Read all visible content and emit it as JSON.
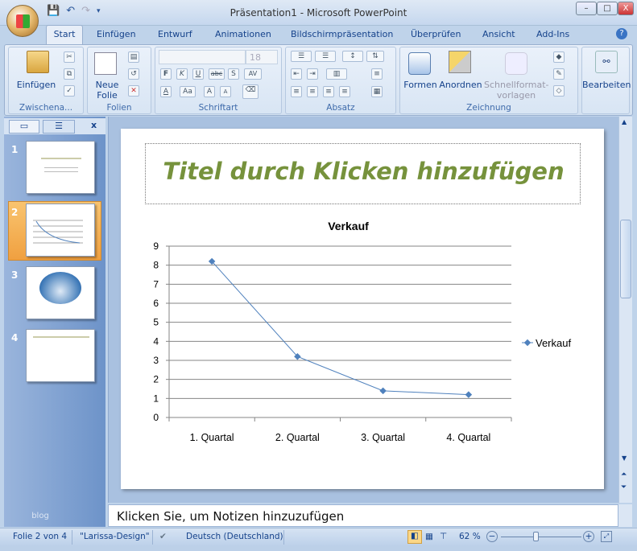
{
  "window": {
    "title": "Präsentation1 - Microsoft PowerPoint",
    "minimize": "–",
    "maximize": "□",
    "close": "X"
  },
  "tabs": [
    "Start",
    "Einfügen",
    "Entwurf",
    "Animationen",
    "Bildschirmpräsentation",
    "Überprüfen",
    "Ansicht",
    "Add-Ins"
  ],
  "ribbon": {
    "clipboard": {
      "paste": "Einfügen",
      "label": "Zwischena..."
    },
    "slides": {
      "new_slide_1": "Neue",
      "new_slide_2": "Folie",
      "label": "Folien"
    },
    "font": {
      "font_name": "",
      "font_size": "18",
      "bold": "F",
      "italic": "K",
      "underline": "U",
      "strike": "abc",
      "shadow": "S",
      "spacing": "AV",
      "color": "A",
      "case": "Aa",
      "grow": "A",
      "shrink": "A",
      "label": "Schriftart"
    },
    "paragraph": {
      "label": "Absatz"
    },
    "drawing": {
      "shapes": "Formen",
      "arrange": "Anordnen",
      "quickstyles_1": "Schnellformat-",
      "quickstyles_2": "vorlagen",
      "label": "Zeichnung"
    },
    "editing": {
      "label": "Bearbeiten"
    }
  },
  "slides_pane": {
    "close": "x",
    "thumbs": [
      {
        "num": "1"
      },
      {
        "num": "2"
      },
      {
        "num": "3"
      },
      {
        "num": "4"
      }
    ],
    "footer": "blog"
  },
  "slide": {
    "title_placeholder": "Titel durch Klicken hinzufügen"
  },
  "chart_data": {
    "type": "line",
    "title": "Verkauf",
    "categories": [
      "1. Quartal",
      "2. Quartal",
      "3. Quartal",
      "4. Quartal"
    ],
    "series": [
      {
        "name": "Verkauf",
        "values": [
          8.2,
          3.2,
          1.4,
          1.2
        ],
        "color": "#4f81bd"
      }
    ],
    "ylim": [
      0,
      9
    ],
    "yticks": [
      "0",
      "1",
      "2",
      "3",
      "4",
      "5",
      "6",
      "7",
      "8",
      "9"
    ],
    "grid": true,
    "legend": "right"
  },
  "notes": {
    "placeholder": "Klicken Sie, um  Notizen hinzuzufügen"
  },
  "status": {
    "slide": "Folie 2 von 4",
    "theme": "\"Larissa-Design\"",
    "language": "Deutsch (Deutschland)",
    "zoom": "62 %",
    "zoom_value": 62
  }
}
